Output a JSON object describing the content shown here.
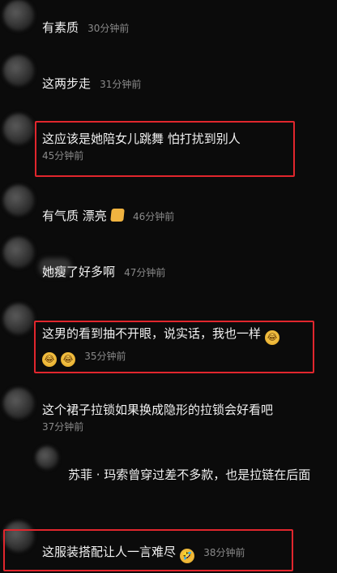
{
  "comments": [
    {
      "text": "有素质",
      "time": "30分钟前"
    },
    {
      "text": "这两步走",
      "time": "31分钟前"
    },
    {
      "text": "这应该是她陪女儿跳舞 怕打扰到别人",
      "time": "45分钟前"
    },
    {
      "text": "有气质 漂亮",
      "emoji": "thumbs-up",
      "time": "46分钟前"
    },
    {
      "text": "她瘦了好多啊",
      "time": "47分钟前"
    },
    {
      "text": "这男的看到抽不开眼，说实话，我也一样",
      "time": "35分钟前"
    },
    {
      "text": "这个裙子拉锁如果换成隐形的拉锁会好看吧",
      "time": "37分钟前"
    },
    {
      "text": "苏菲 · 玛索曾穿过差不多款，也是拉链在后面"
    },
    {
      "text": "这服装搭配让人一言难尽",
      "time": "38分钟前"
    }
  ],
  "colors": {
    "highlight": "#e1262d",
    "background": "#0b0b0b",
    "time": "#8a8a8a"
  }
}
